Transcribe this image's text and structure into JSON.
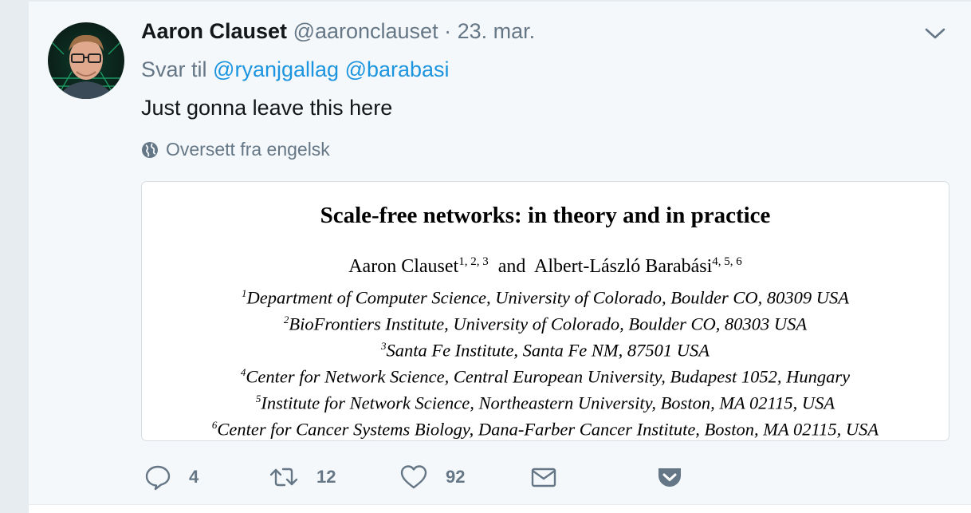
{
  "tweet": {
    "author_name": "Aaron Clauset",
    "author_handle": "@aaronclauset",
    "separator": "·",
    "date": "23. mar.",
    "reply_prefix": "Svar til",
    "reply_mentions": [
      "@ryanjgallag",
      "@barabasi"
    ],
    "text": "Just gonna leave this here",
    "translate_label": "Oversett fra engelsk"
  },
  "media": {
    "title": "Scale-free networks: in theory and in practice",
    "author1": "Aaron Clauset",
    "author1_sup": "1, 2, 3",
    "and": "and",
    "author2": "Albert-László Barabási",
    "author2_sup": "4, 5, 6",
    "affiliations": [
      {
        "num": "1",
        "text": "Department of Computer Science, University of Colorado, Boulder CO, 80309 USA"
      },
      {
        "num": "2",
        "text": "BioFrontiers Institute, University of Colorado, Boulder CO, 80303 USA"
      },
      {
        "num": "3",
        "text": "Santa Fe Institute, Santa Fe NM, 87501 USA"
      },
      {
        "num": "4",
        "text": "Center for Network Science, Central European University, Budapest 1052, Hungary"
      },
      {
        "num": "5",
        "text": "Institute for Network Science, Northeastern University, Boston, MA 02115, USA"
      },
      {
        "num": "6",
        "text": "Center for Cancer Systems Biology, Dana-Farber Cancer Institute, Boston, MA 02115, USA"
      }
    ]
  },
  "actions": {
    "reply_count": "4",
    "retweet_count": "12",
    "like_count": "92"
  },
  "icons": {
    "reply": "speech-bubble-icon",
    "retweet": "retweet-arrows-icon",
    "like": "heart-icon",
    "dm": "envelope-icon",
    "pocket": "pocket-icon",
    "caret": "chevron-down-icon",
    "globe": "globe-icon"
  },
  "colors": {
    "link": "#1b95e0",
    "muted": "#657786",
    "text": "#14171a",
    "pocket": "#657786"
  }
}
